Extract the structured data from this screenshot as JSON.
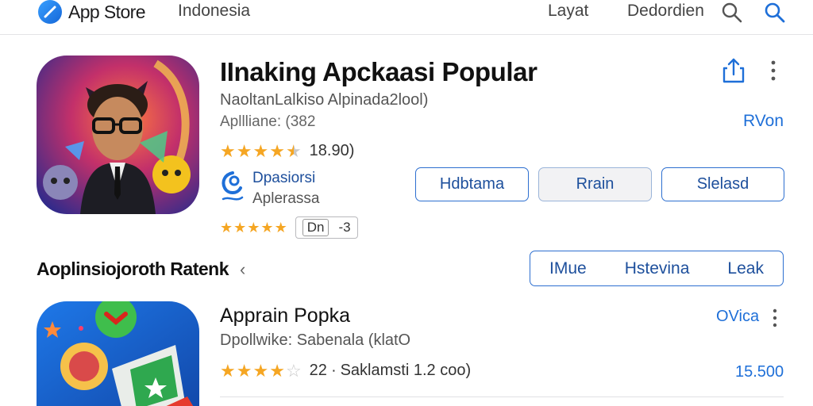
{
  "header": {
    "brand": "App Store",
    "region": "Indonesia",
    "nav_layout": "Layat",
    "nav_second": "Dedordien",
    "search_icon": "search-icon",
    "search_active_icon": "search-icon"
  },
  "featured": {
    "title": "IInaking Apckaasi Popular",
    "subtitle": "NaoltanLalkiso Alpinada2lool)",
    "meta": "Apllliane: (382",
    "price": "RVon",
    "rating_value": 4.5,
    "rating_count": "18.90)",
    "developer_name": "Dpasiorsi",
    "developer_sub": "Aplerassa",
    "tag_badge": "Dn",
    "tag_count": "-3",
    "buttons": [
      "Hdbtama",
      "Rrain",
      "Slelasd"
    ]
  },
  "section": {
    "title": "Aoplinsiojoroth Ratenk",
    "chevron": "‹",
    "segments": [
      "IMue",
      "Hstevina",
      "Leak"
    ]
  },
  "second_app": {
    "title": "Apprain Popka",
    "subtitle": "Dpollwike: Sabenala (klatO",
    "price": "OVica",
    "rating_value": 4,
    "rating_text": "22 ∙ Saklamsti 1.2 coo)",
    "count": "15.500"
  },
  "colors": {
    "accent": "#1e6fd8",
    "star": "#f5a623"
  }
}
